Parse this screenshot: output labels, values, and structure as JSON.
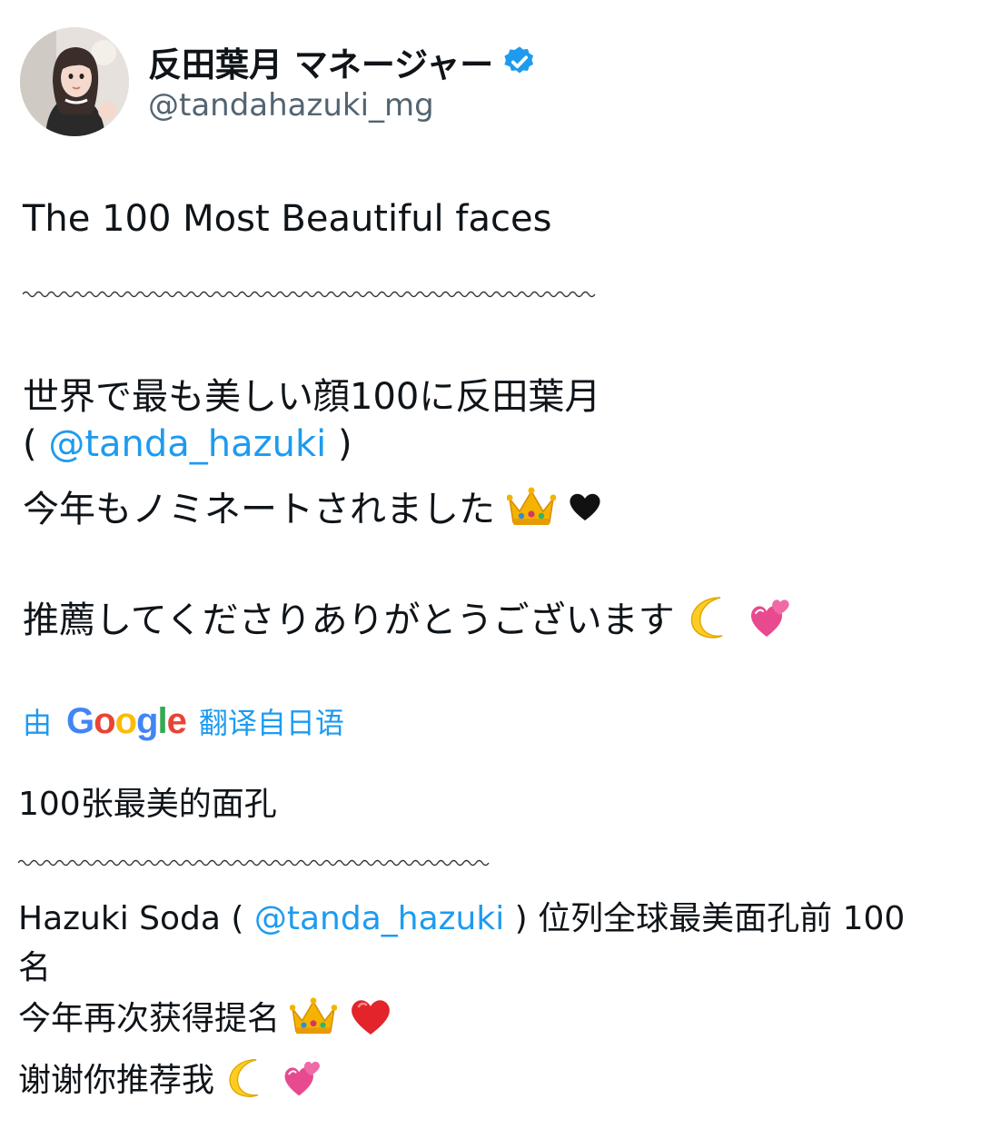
{
  "author": {
    "display_name": "反田葉月 マネージャー",
    "handle": "@tandahazuki_mg",
    "verified": true,
    "accent_color": "#1d9bf0"
  },
  "original": {
    "title": "The 100 Most Beautiful faces",
    "line1": "世界で最も美しい顔100に反田葉月",
    "line2_open": "(",
    "line2_mention": "@tanda_hazuki",
    "line2_close": ")",
    "line3": "今年もノミネートされました",
    "line4": "推薦してくださりありがとうございます"
  },
  "translation": {
    "by_label": "由",
    "provider": "Google",
    "provider_letters": [
      "G",
      "o",
      "o",
      "g",
      "l",
      "e"
    ],
    "from_label": "翻译自日语",
    "title": "100张最美的面孔",
    "line1_prefix": "Hazuki Soda (",
    "line1_mention": "@tanda_hazuki",
    "line1_suffix": ") 位列全球最美面孔前 100",
    "line1_wrap": "名",
    "line2": "今年再次获得提名",
    "line3": "谢谢你推荐我"
  },
  "icons": {
    "verified": "verified-badge-icon",
    "crown": "crown-emoji",
    "heart_black": "black-heart-emoji",
    "heart_red": "red-heart-emoji",
    "moon": "crescent-moon-emoji",
    "hearts": "two-hearts-emoji"
  }
}
